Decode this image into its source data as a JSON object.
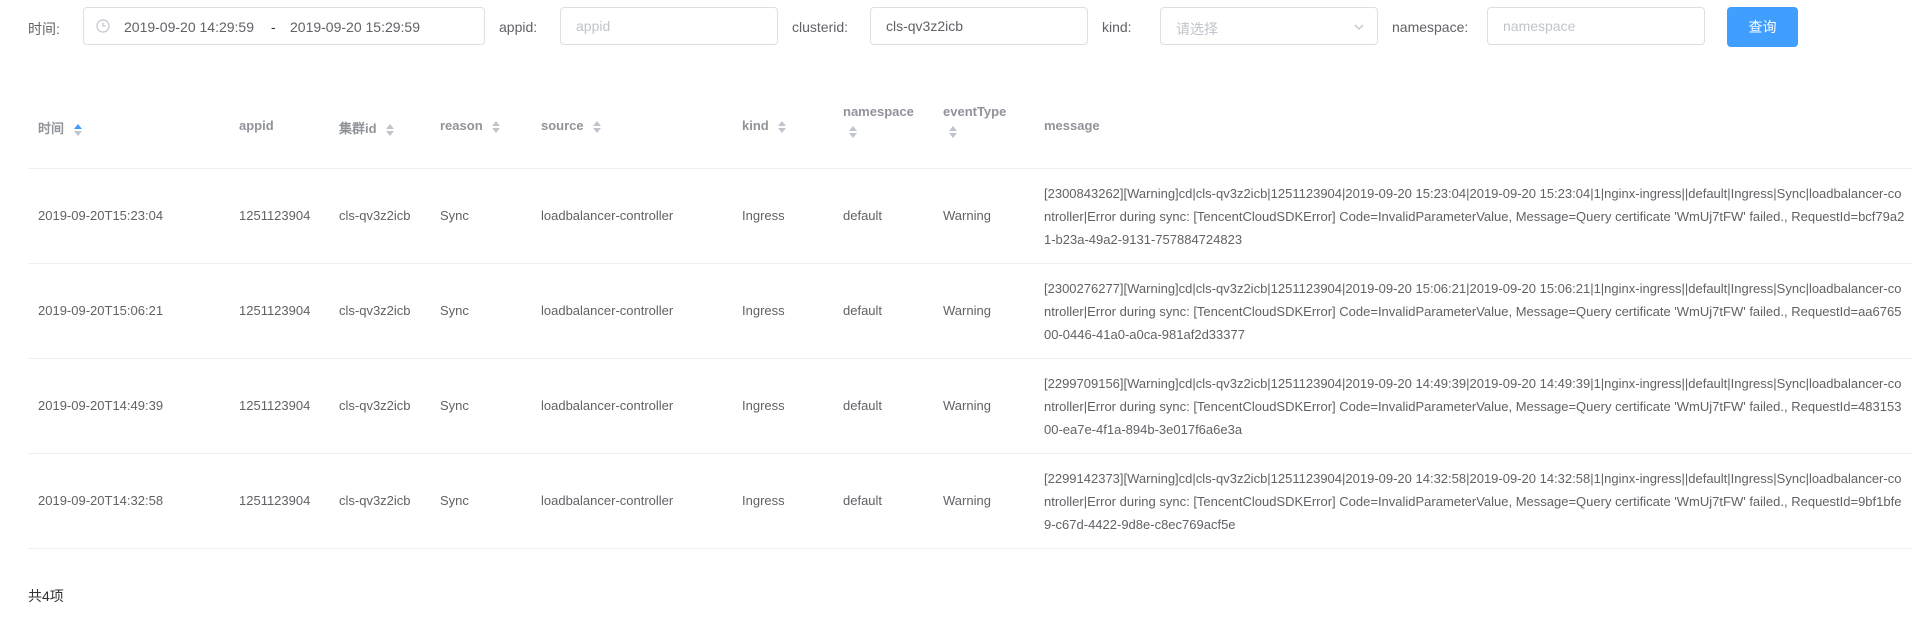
{
  "filters": {
    "time_label": "时间:",
    "time_start": "2019-09-20 14:29:59",
    "time_separator": "-",
    "time_end": "2019-09-20 15:29:59",
    "appid_label": "appid:",
    "appid_placeholder": "appid",
    "clusterid_label": "clusterid:",
    "clusterid_value": "cls-qv3z2icb",
    "kind_label": "kind:",
    "kind_placeholder": "请选择",
    "namespace_label": "namespace:",
    "namespace_placeholder": "namespace",
    "query_button": "查询"
  },
  "table": {
    "columns": {
      "time": "时间",
      "appid": "appid",
      "clusterid": "集群id",
      "reason": "reason",
      "source": "source",
      "kind": "kind",
      "namespace": "namespace",
      "eventType": "eventType",
      "message": "message"
    },
    "rows": [
      {
        "time": "2019-09-20T15:23:04",
        "appid": "1251123904",
        "clusterid": "cls-qv3z2icb",
        "reason": "Sync",
        "source": "loadbalancer-controller",
        "kind": "Ingress",
        "namespace": "default",
        "eventType": "Warning",
        "message": "[2300843262][Warning]cd|cls-qv3z2icb|1251123904|2019-09-20 15:23:04|2019-09-20 15:23:04|1|nginx-ingress||default|Ingress|Sync|loadbalancer-controller|Error during sync: [TencentCloudSDKError] Code=InvalidParameterValue, Message=Query certificate 'WmUj7tFW' failed., RequestId=bcf79a21-b23a-49a2-9131-757884724823"
      },
      {
        "time": "2019-09-20T15:06:21",
        "appid": "1251123904",
        "clusterid": "cls-qv3z2icb",
        "reason": "Sync",
        "source": "loadbalancer-controller",
        "kind": "Ingress",
        "namespace": "default",
        "eventType": "Warning",
        "message": "[2300276277][Warning]cd|cls-qv3z2icb|1251123904|2019-09-20 15:06:21|2019-09-20 15:06:21|1|nginx-ingress||default|Ingress|Sync|loadbalancer-controller|Error during sync: [TencentCloudSDKError] Code=InvalidParameterValue, Message=Query certificate 'WmUj7tFW' failed., RequestId=aa676500-0446-41a0-a0ca-981af2d33377"
      },
      {
        "time": "2019-09-20T14:49:39",
        "appid": "1251123904",
        "clusterid": "cls-qv3z2icb",
        "reason": "Sync",
        "source": "loadbalancer-controller",
        "kind": "Ingress",
        "namespace": "default",
        "eventType": "Warning",
        "message": "[2299709156][Warning]cd|cls-qv3z2icb|1251123904|2019-09-20 14:49:39|2019-09-20 14:49:39|1|nginx-ingress||default|Ingress|Sync|loadbalancer-controller|Error during sync: [TencentCloudSDKError] Code=InvalidParameterValue, Message=Query certificate 'WmUj7tFW' failed., RequestId=48315300-ea7e-4f1a-894b-3e017f6a6e3a"
      },
      {
        "time": "2019-09-20T14:32:58",
        "appid": "1251123904",
        "clusterid": "cls-qv3z2icb",
        "reason": "Sync",
        "source": "loadbalancer-controller",
        "kind": "Ingress",
        "namespace": "default",
        "eventType": "Warning",
        "message": "[2299142373][Warning]cd|cls-qv3z2icb|1251123904|2019-09-20 14:32:58|2019-09-20 14:32:58|1|nginx-ingress||default|Ingress|Sync|loadbalancer-controller|Error during sync: [TencentCloudSDKError] Code=InvalidParameterValue, Message=Query certificate 'WmUj7tFW' failed., RequestId=9bf1bfe9-c67d-4422-9d8e-c8ec769acf5e"
      }
    ]
  },
  "pagination": {
    "total_text": "共4项"
  },
  "colors": {
    "primary": "#409eff",
    "border": "#dcdfe6",
    "header_text": "#909399",
    "body_text": "#606266"
  }
}
